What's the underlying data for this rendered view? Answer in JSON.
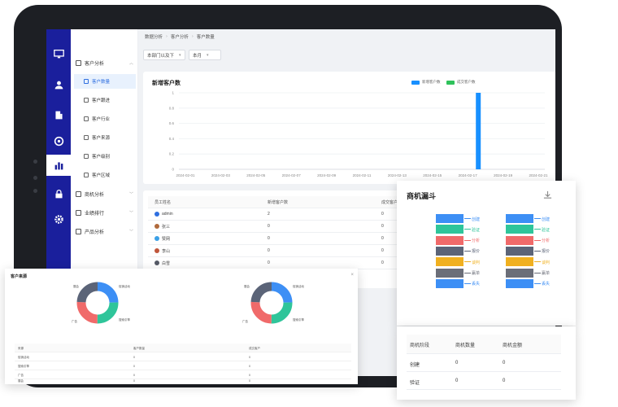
{
  "breadcrumb": [
    "数据分析",
    "客户分析",
    "客户数量"
  ],
  "filters": {
    "dept": "本部门以及下",
    "period": "本月"
  },
  "rail_icons": [
    "monitor-icon",
    "users-icon",
    "building-icon",
    "target-icon",
    "bar-chart-icon",
    "lock-icon",
    "gear-icon"
  ],
  "menu": {
    "group_customer": "客户分析",
    "items": [
      "客户数量",
      "客户跟进",
      "客户行业",
      "客户来源",
      "客户级别",
      "客户区域"
    ],
    "group_business": "商机分析",
    "group_rank": "业绩排行",
    "group_product": "产品分析"
  },
  "chart": {
    "title": "新增客户数",
    "legend": [
      "新增客户数",
      "成交客户数"
    ]
  },
  "chart_data": {
    "type": "bar",
    "title": "新增客户数",
    "categories": [
      "2024-02-01",
      "2024-02-03",
      "2024-02-05",
      "2024-02-07",
      "2024-02-09",
      "2024-02-11",
      "2024-02-13",
      "2024-02-15",
      "2024-02-17",
      "2024-02-19",
      "2024-02-21"
    ],
    "y_ticks": [
      "0",
      "0.2",
      "0.4",
      "0.6",
      "0.8",
      "1"
    ],
    "ylim": [
      0,
      1
    ],
    "series": [
      {
        "name": "新增客户数",
        "color": "#1890ff",
        "points": [
          {
            "x": "2024-02-17",
            "y": 1
          }
        ]
      },
      {
        "name": "成交客户数",
        "color": "#2fc25b",
        "points": []
      }
    ],
    "grid": true,
    "legend_position": "top-right"
  },
  "table": {
    "headers": [
      "员工姓名",
      "新增客户数",
      "成交客户数"
    ],
    "rows": [
      {
        "name": "admin",
        "new": "2",
        "deal": "0",
        "avatar": "#2f6fe0"
      },
      {
        "name": "张三",
        "new": "0",
        "deal": "0",
        "avatar": "#b06a3c"
      },
      {
        "name": "赞网",
        "new": "0",
        "deal": "0",
        "avatar": "#3ba0e6"
      },
      {
        "name": "李山",
        "new": "0",
        "deal": "0",
        "avatar": "#c0563b"
      },
      {
        "name": "白雪",
        "new": "0",
        "deal": "0",
        "avatar": "#555a66"
      }
    ]
  },
  "source_card": {
    "title": "客户来源",
    "close": "×",
    "pie_labels": [
      "展会",
      "促销活动",
      "广告",
      "搜索引擎"
    ],
    "table_headers": [
      "来源",
      "客户数量",
      "成交客户"
    ],
    "table_rows": [
      [
        "促销活动",
        "0",
        "0"
      ],
      [
        "搜索引擎",
        "0",
        "0"
      ],
      [
        "广告",
        "0",
        "0"
      ],
      [
        "展会",
        "0",
        "0"
      ]
    ]
  },
  "funnel": {
    "title": "商机漏斗",
    "download_icon": "download-icon",
    "stages": [
      {
        "label": "创建",
        "color": "#3d8ff5"
      },
      {
        "label": "验证",
        "color": "#2fc59a"
      },
      {
        "label": "分析",
        "color": "#f06a6a"
      },
      {
        "label": "报价",
        "color": "#5b6478"
      },
      {
        "label": "谈判",
        "color": "#f0b020"
      },
      {
        "label": "赢单",
        "color": "#6b6e78"
      },
      {
        "label": "丢失",
        "color": "#3d8ff5"
      }
    ]
  },
  "deal_table": {
    "headers": [
      "商机阶段",
      "商机数量",
      "商机金额"
    ],
    "rows": [
      [
        "创建",
        "0",
        "0"
      ],
      [
        "验证",
        "0",
        "0"
      ]
    ]
  }
}
